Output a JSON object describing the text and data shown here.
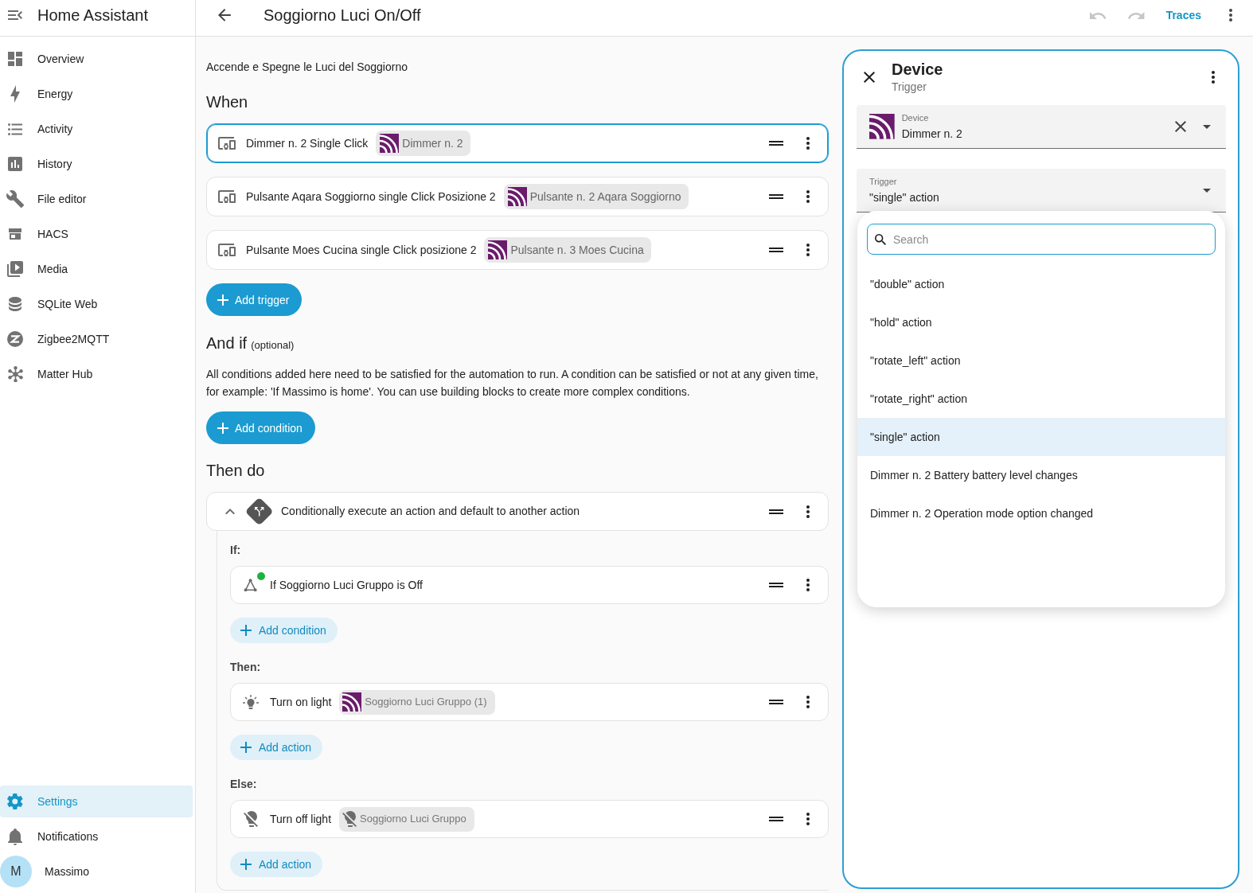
{
  "sidebar": {
    "title": "Home Assistant",
    "items": [
      {
        "label": "Overview",
        "selected": false
      },
      {
        "label": "Energy",
        "selected": false
      },
      {
        "label": "Activity",
        "selected": false
      },
      {
        "label": "History",
        "selected": false
      },
      {
        "label": "File editor",
        "selected": false
      },
      {
        "label": "HACS",
        "selected": false
      },
      {
        "label": "Media",
        "selected": false
      },
      {
        "label": "SQLite Web",
        "selected": false
      },
      {
        "label": "Zigbee2MQTT",
        "selected": false
      },
      {
        "label": "Matter Hub",
        "selected": false
      }
    ],
    "bottom_items": [
      {
        "label": "Settings",
        "selected": true
      },
      {
        "label": "Notifications",
        "selected": false
      }
    ],
    "user": {
      "initial": "M",
      "name": "Massimo"
    }
  },
  "toolbar": {
    "title": "Soggiorno Luci On/Off",
    "undo": {
      "disabled": true
    },
    "redo": {
      "disabled": true
    },
    "link": "Traces"
  },
  "editor": {
    "description": "Accende e Spegne le Luci del Soggiorno",
    "triggers": {
      "heading": "When",
      "items": [
        {
          "text": "Dimmer n. 2 Single Click",
          "device": "Dimmer n. 2",
          "selected": true
        },
        {
          "text": "Pulsante Aqara Soggiorno single Click Posizione 2",
          "device": "Pulsante n. 2 Aqara Soggiorno",
          "selected": false
        },
        {
          "text": "Pulsante Moes Cucina single Click posizione 2",
          "device": "Pulsante n. 3 Moes Cucina",
          "selected": false
        }
      ],
      "add_button": "Add trigger"
    },
    "conditions": {
      "heading": "And if",
      "note": "(optional)",
      "help": "All conditions added here need to be satisfied for the automation to run. A condition can be satisfied or not at any given time, for example: 'If Massimo is home'. You can use building blocks to create more complex conditions.",
      "add_button": "Add condition"
    },
    "actions": {
      "heading": "Then do",
      "items": [
        {
          "kind": "choose",
          "title": "Conditionally execute an action and default to another action",
          "expanded": true,
          "branches": [
            {
              "label": "If:",
              "items": [
                {
                  "kind": "condition",
                  "text": "If Soggiorno Luci Gruppo is Off",
                  "active": true
                }
              ],
              "add_button": "Add condition"
            },
            {
              "label": "Then:",
              "items": [
                {
                  "kind": "light_on",
                  "text": "Turn on light",
                  "chip": {
                    "kind": "device",
                    "label": "Soggiorno Luci Gruppo (1)"
                  }
                }
              ],
              "add_button": "Add action"
            },
            {
              "label": "Else:",
              "items": [
                {
                  "kind": "light_off",
                  "text": "Turn off light",
                  "chip": {
                    "kind": "entity",
                    "label": "Soggiorno Luci Gruppo"
                  }
                }
              ],
              "add_button": "Add action"
            }
          ]
        }
      ]
    }
  },
  "panel": {
    "title": "Device",
    "subtitle": "Trigger",
    "device_field": {
      "label": "Device",
      "value": "Dimmer n. 2"
    },
    "trigger_field": {
      "label": "Trigger",
      "value": "\"single\" action",
      "open": true
    },
    "search": {
      "placeholder": "Search",
      "focused": true
    },
    "options": [
      {
        "label": "\"double\" action",
        "selected": false
      },
      {
        "label": "\"hold\" action",
        "selected": false
      },
      {
        "label": "\"rotate_left\" action",
        "selected": false
      },
      {
        "label": "\"rotate_right\" action",
        "selected": false
      },
      {
        "label": "\"single\" action",
        "selected": true
      },
      {
        "label": "Dimmer n. 2 Battery battery level changes",
        "selected": false
      },
      {
        "label": "Dimmer n. 2 Operation mode option changed",
        "selected": false
      }
    ]
  }
}
